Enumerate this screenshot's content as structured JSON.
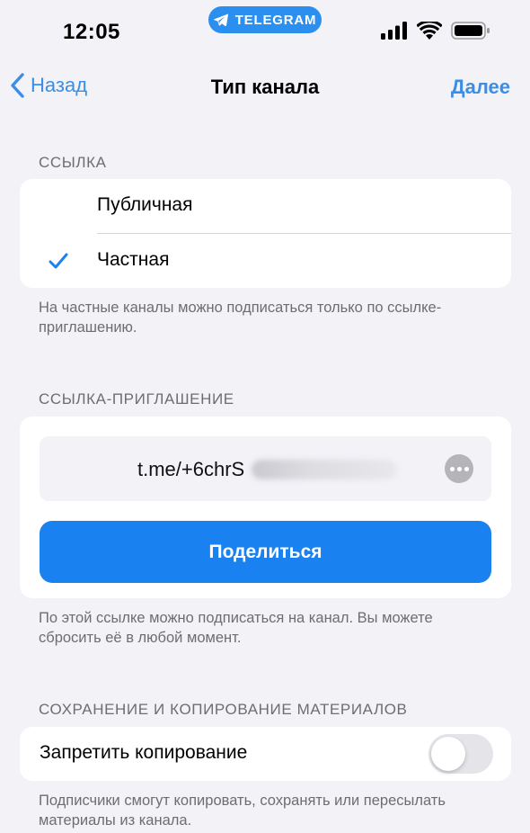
{
  "status_bar": {
    "time": "12:05",
    "app_pill": "TELEGRAM",
    "icons": [
      "signal-icon",
      "wifi-icon",
      "battery-icon"
    ]
  },
  "nav": {
    "back_label": "Назад",
    "title": "Тип канала",
    "next_label": "Далее"
  },
  "link_section": {
    "header": "ССЫЛКА",
    "options": [
      {
        "label": "Публичная",
        "selected": false
      },
      {
        "label": "Частная",
        "selected": true
      }
    ],
    "footnote": "На частные каналы можно подписаться только по ссылке-приглашению."
  },
  "invite_section": {
    "header": "ССЫЛКА-ПРИГЛАШЕНИЕ",
    "link_text": "t.me/+6chrS",
    "share_label": "Поделиться",
    "footnote": "По этой ссылке можно подписаться на канал. Вы можете сбросить её в любой момент."
  },
  "saving_section": {
    "header": "СОХРАНЕНИЕ И КОПИРОВАНИЕ МАТЕРИАЛОВ",
    "toggle_label": "Запретить копирование",
    "toggle_on": false,
    "footnote": "Подписчики смогут копировать, сохранять или пересылать материалы из канала."
  },
  "colors": {
    "accent": "#1a82f0",
    "link_blue": "#3a8ee6",
    "background": "#f2f2f7",
    "secondary_text": "#6d6d72"
  }
}
